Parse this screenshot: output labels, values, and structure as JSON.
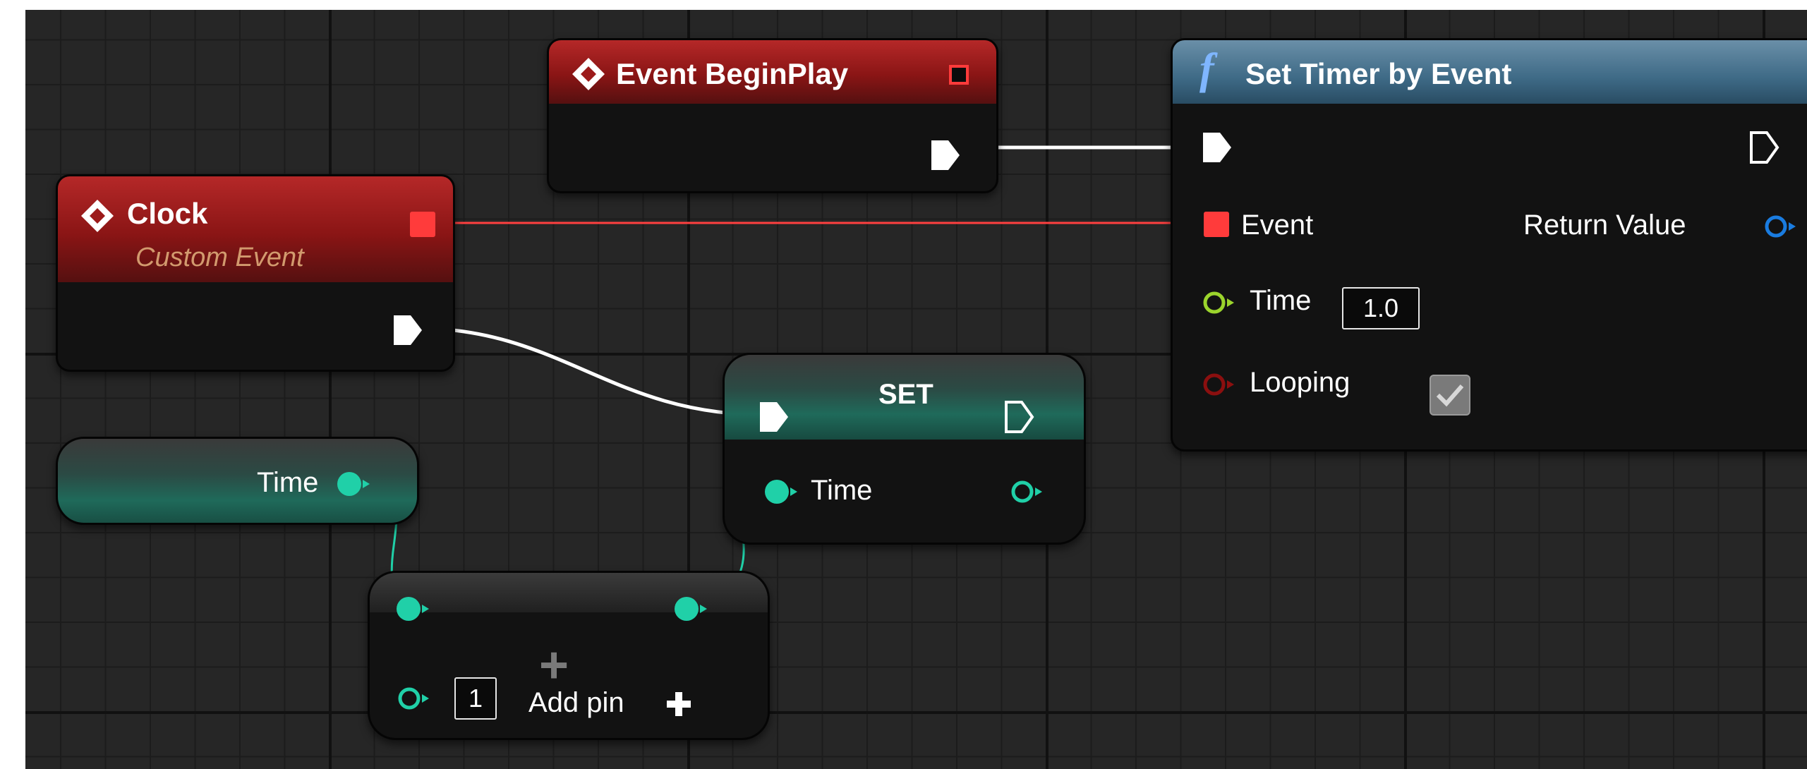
{
  "graph": {
    "nodes": {
      "event_beginplay": {
        "title": "Event BeginPlay"
      },
      "clock": {
        "title": "Clock",
        "subtitle": "Custom Event"
      },
      "set_timer": {
        "title": "Set Timer by Event",
        "pins": {
          "event": "Event",
          "return_value": "Return Value",
          "time": "Time",
          "time_value": "1.0",
          "looping": "Looping",
          "looping_checked": true
        }
      },
      "time_getter": {
        "label": "Time"
      },
      "set_node": {
        "title": "SET",
        "pin_label": "Time"
      },
      "add_node": {
        "input_value": "1",
        "add_pin_label": "Add pin"
      }
    }
  },
  "colors": {
    "exec": "#ffffff",
    "delegate": "#ff3b3b",
    "float": "#20d0a8",
    "time_float": "#9bd42c",
    "bool": "#8b0f0f",
    "object": "#1a7ce0"
  }
}
